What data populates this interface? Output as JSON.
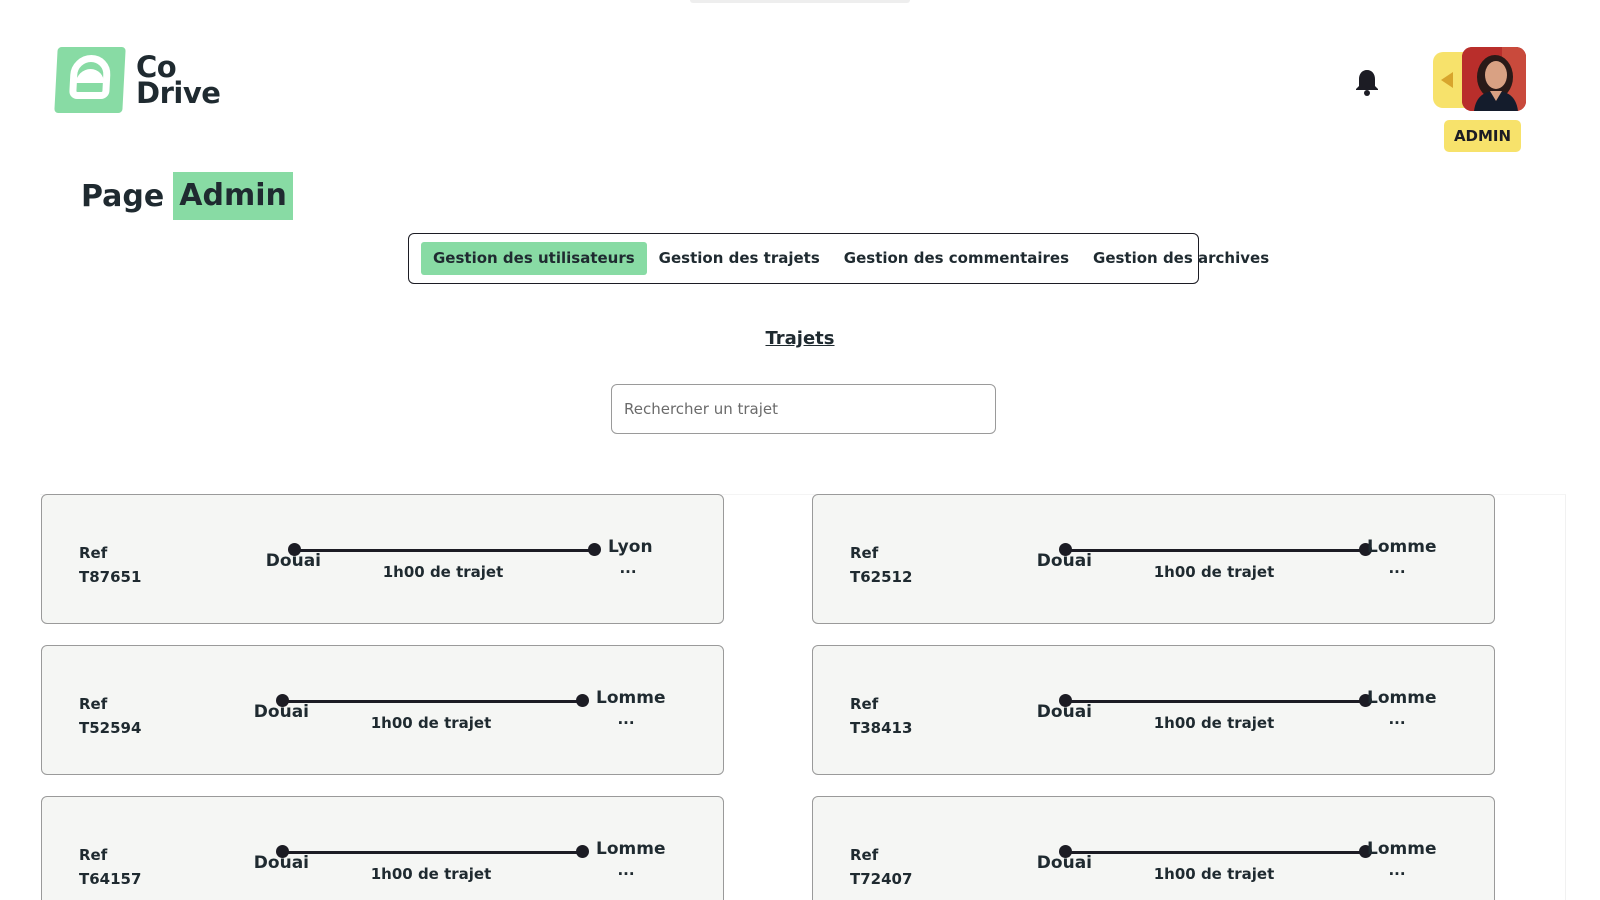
{
  "logo": {
    "line1": "Co",
    "line2": "Drive"
  },
  "header": {
    "notification_icon": "bell-icon",
    "user_role": "ADMIN",
    "toggle_icon": "caret-left-icon"
  },
  "page": {
    "title_prefix": "Page",
    "title_highlight": "Admin"
  },
  "tabs": [
    {
      "label": "Gestion des utilisateurs",
      "active": true
    },
    {
      "label": "Gestion des trajets",
      "active": false
    },
    {
      "label": "Gestion des commentaires",
      "active": false
    },
    {
      "label": "Gestion des archives",
      "active": false
    }
  ],
  "section": {
    "title": "Trajets"
  },
  "search": {
    "placeholder": "Rechercher un trajet",
    "value": ""
  },
  "trips": [
    {
      "ref_label": "Ref",
      "ref": "T87651",
      "origin": "Douai",
      "destination": "Lyon",
      "duration": "1h00 de trajet",
      "more": "..."
    },
    {
      "ref_label": "Ref",
      "ref": "T62512",
      "origin": "Douai",
      "destination": "Lomme",
      "duration": "1h00 de trajet",
      "more": "..."
    },
    {
      "ref_label": "Ref",
      "ref": "T52594",
      "origin": "Douai",
      "destination": "Lomme",
      "duration": "1h00 de trajet",
      "more": "..."
    },
    {
      "ref_label": "Ref",
      "ref": "T38413",
      "origin": "Douai",
      "destination": "Lomme",
      "duration": "1h00 de trajet",
      "more": "..."
    },
    {
      "ref_label": "Ref",
      "ref": "T64157",
      "origin": "Douai",
      "destination": "Lomme",
      "duration": "1h00 de trajet",
      "more": "..."
    },
    {
      "ref_label": "Ref",
      "ref": "T72407",
      "origin": "Douai",
      "destination": "Lomme",
      "duration": "1h00 de trajet",
      "more": "..."
    }
  ],
  "colors": {
    "brand_green": "#88dba4",
    "accent_yellow": "#f7e26b",
    "text_dark": "#1f2a30",
    "card_bg": "#f5f6f4"
  }
}
